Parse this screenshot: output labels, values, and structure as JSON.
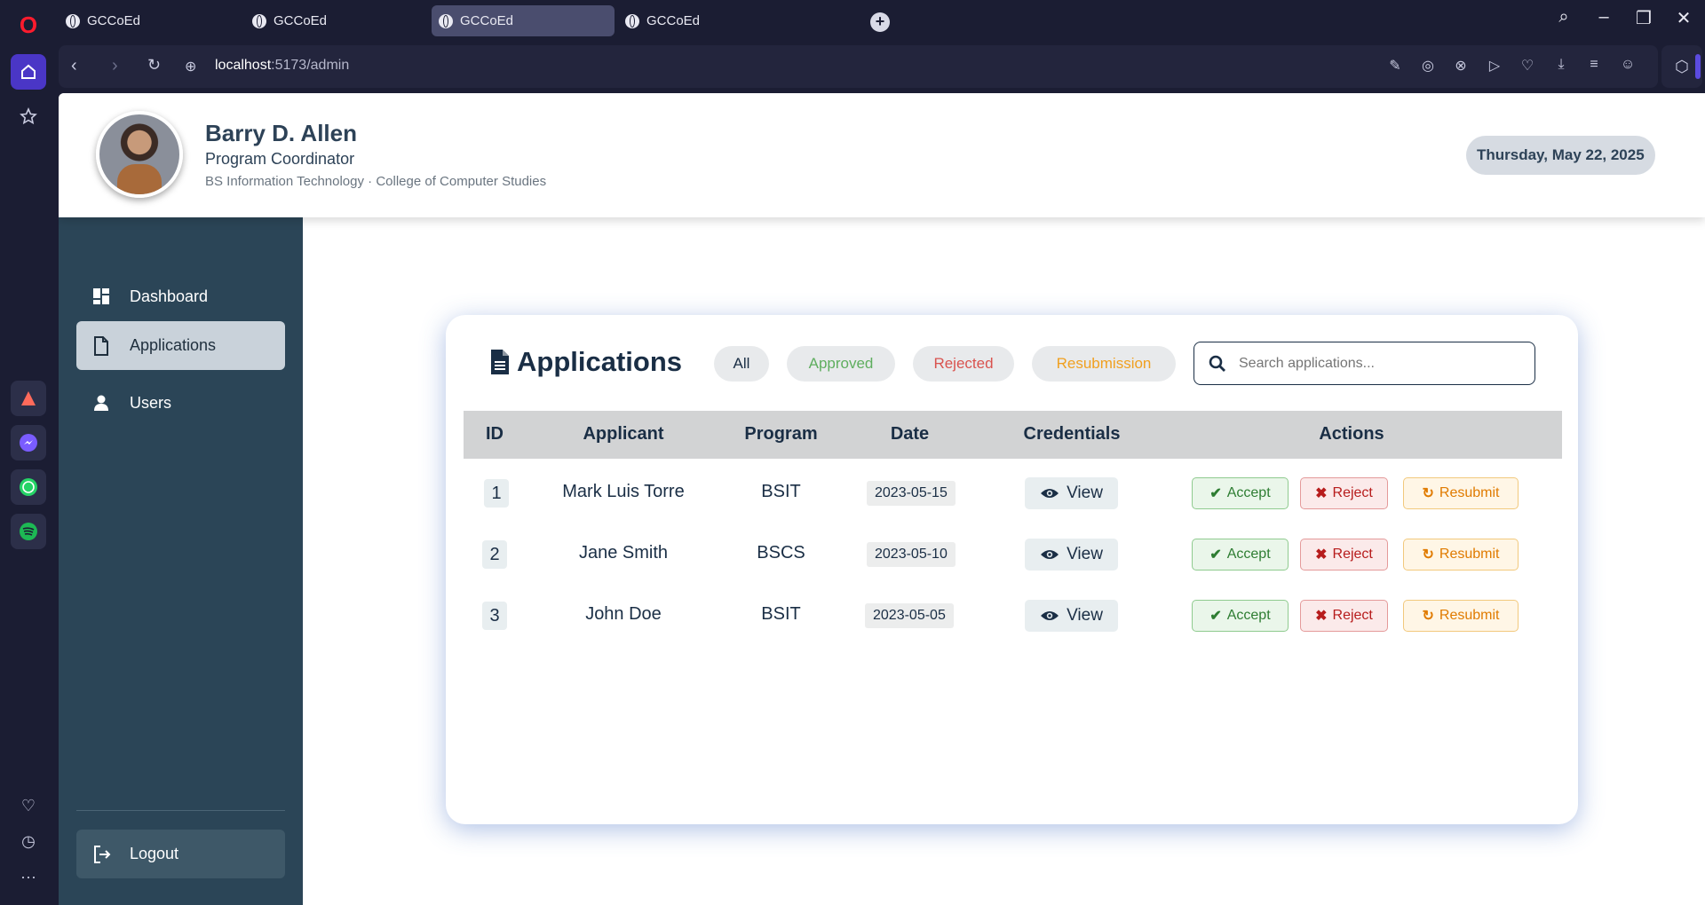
{
  "browser": {
    "tabs": [
      {
        "title": "GCCoEd"
      },
      {
        "title": "GCCoEd"
      },
      {
        "title": "GCCoEd"
      },
      {
        "title": "GCCoEd"
      }
    ],
    "url_host": "localhost",
    "url_path": ":5173/admin"
  },
  "profile": {
    "name": "Barry D. Allen",
    "role": "Program Coordinator",
    "department": "BS Information Technology · College of Computer Studies"
  },
  "date": "Thursday, May 22, 2025",
  "sidebar": {
    "items": [
      {
        "label": "Dashboard"
      },
      {
        "label": "Applications"
      },
      {
        "label": "Users"
      }
    ],
    "logout": "Logout"
  },
  "applications": {
    "title": "Applications",
    "filters": [
      "All",
      "Approved",
      "Rejected",
      "Resubmission"
    ],
    "search_placeholder": "Search applications...",
    "columns": [
      "ID",
      "Applicant",
      "Program",
      "Date",
      "Credentials",
      "Actions"
    ],
    "rows": [
      {
        "id": "1",
        "applicant": "Mark Luis Torre",
        "program": "BSIT",
        "date": "2023-05-15",
        "view": "View",
        "accept": "Accept",
        "reject": "Reject",
        "resubmit": "Resubmit"
      },
      {
        "id": "2",
        "applicant": "Jane Smith",
        "program": "BSCS",
        "date": "2023-05-10",
        "view": "View",
        "accept": "Accept",
        "reject": "Reject",
        "resubmit": "Resubmit"
      },
      {
        "id": "3",
        "applicant": "John Doe",
        "program": "BSIT",
        "date": "2023-05-05",
        "view": "View",
        "accept": "Accept",
        "reject": "Reject",
        "resubmit": "Resubmit"
      }
    ]
  },
  "colors": {
    "sidebar_bg": "#2b4557",
    "accent_dark": "#1a2e45",
    "approved": "#4caf50",
    "rejected": "#d9534f",
    "resubmission": "#f0a020"
  }
}
